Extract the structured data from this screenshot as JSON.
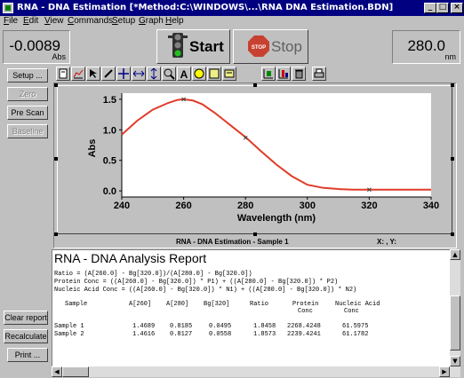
{
  "window": {
    "title": "RNA - DNA Estimation [*Method:C:\\WINDOWS\\...\\RNA DNA Estimation.BDN]"
  },
  "menu": [
    "File",
    "Edit",
    "View",
    "Commands",
    "Setup",
    "Graph",
    "Help"
  ],
  "readouts": {
    "absorbance": {
      "value": "-0.0089",
      "unit": "Abs"
    },
    "wavelength": {
      "value": "280.0",
      "unit": "nm"
    }
  },
  "controls": {
    "start_label": "Start",
    "stop_label": "Stop"
  },
  "side_buttons": {
    "setup": "Setup ...",
    "zero": "Zero",
    "prescan": "Pre Scan",
    "baseline": "Baseline",
    "clear_report": "Clear report",
    "recalculate": "Recalculate",
    "print": "Print ..."
  },
  "toolbar_icons": [
    "edit-icon",
    "graph-icon",
    "pointer-icon",
    "pen-icon",
    "move-icon",
    "scale-x-icon",
    "scale-y-icon",
    "zoom-icon",
    "text-icon",
    "label-icon",
    "copy-icon",
    "export-icon",
    "autoscale-icon",
    "stack-icon",
    "trash-icon",
    "print-graph-icon"
  ],
  "graph": {
    "caption": "RNA - DNA Estimation - Sample 1",
    "cursor_readout": "X: , Y:"
  },
  "chart_data": {
    "type": "line",
    "title": "",
    "xlabel": "Wavelength (nm)",
    "ylabel": "Abs",
    "xlim": [
      240,
      340
    ],
    "ylim": [
      -0.1,
      1.6
    ],
    "xticks": [
      240,
      260,
      280,
      300,
      320,
      340
    ],
    "yticks": [
      0.0,
      0.5,
      1.0,
      1.5
    ],
    "grid": false,
    "line_color": "#e03c28",
    "marker_color": "#404040",
    "series": [
      {
        "x": [
          240,
          245,
          250,
          255,
          258,
          260,
          263,
          266,
          270,
          275,
          280,
          285,
          290,
          295,
          300,
          305,
          310,
          315,
          320,
          325,
          330,
          335,
          340
        ],
        "values": [
          0.92,
          1.15,
          1.33,
          1.44,
          1.49,
          1.5,
          1.48,
          1.42,
          1.28,
          1.08,
          0.88,
          0.65,
          0.43,
          0.24,
          0.1,
          0.05,
          0.03,
          0.02,
          0.02,
          0.02,
          0.02,
          0.02,
          0.02
        ]
      }
    ],
    "markers": [
      {
        "x": 260,
        "y": 1.5
      },
      {
        "x": 280,
        "y": 0.87
      },
      {
        "x": 320,
        "y": 0.02
      }
    ]
  },
  "report": {
    "title": "RNA - DNA Analysis Report",
    "formulas": [
      "Ratio = (A[260.0] - Bg[320.0])/(A[280.0] - Bg[320.0])",
      "Protein Conc = ((A[260.0] - Bg[320.0]) * P1) + ((A[280.0] - Bg[320.0]) * P2)",
      "Nucleic Acid Conc = ((A[260.0] - Bg[320.0]) * N1) + ((A[280.0] - Bg[320.0]) * N2)"
    ],
    "columns": [
      "Sample",
      "A[260]",
      "A[280]",
      "Bg[320]",
      "Ratio",
      "Protein",
      "Nucleic Acid"
    ],
    "columns_sub": [
      "",
      "",
      "",
      "",
      "",
      "Conc",
      "Conc"
    ],
    "rows": [
      [
        "Sample 1",
        "1.4689",
        "0.8185",
        "0.0495",
        "1.8458",
        "2268.4248",
        "61.5975"
      ],
      [
        "Sample 2",
        "1.4616",
        "0.8127",
        "0.0558",
        "1.8573",
        "2239.4241",
        "61.1782"
      ]
    ]
  }
}
